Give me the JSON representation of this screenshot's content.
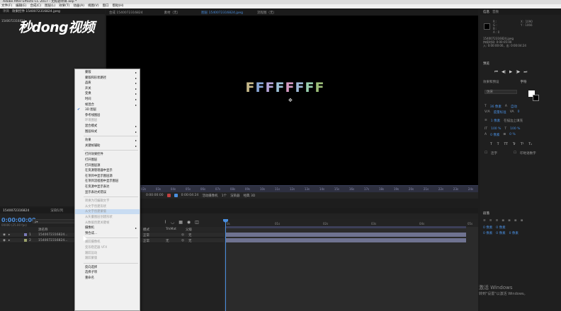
{
  "window": {
    "title_bar": "Adobe After Effects CC 2017 - 无标题项目.aep *",
    "menu": [
      "文件(F)",
      "编辑(E)",
      "合成(C)",
      "图层(L)",
      "效果(T)",
      "动画(A)",
      "视图(V)",
      "窗口",
      "帮助(H)"
    ]
  },
  "project_panel": {
    "tabs": [
      "项目",
      "效果控件 1540072316824.jpeg"
    ],
    "item_label": "1540072316824...",
    "watermark_logo": "秒dong视频"
  },
  "viewer": {
    "tabs": [
      "合成 1540072316824",
      "素材（无）",
      "图层 1540072316824.jpeg",
      "流程图（无）"
    ],
    "text_chars": [
      "F",
      "F",
      "F",
      "F",
      "F",
      "F",
      "F",
      "F"
    ],
    "text_colors": [
      "#c7b98a",
      "#8aa7d6",
      "#b6a6d8",
      "#9fc2d8",
      "#d49bc3",
      "#9fb8d6",
      "#9ad0b0",
      "#9dbf7a"
    ],
    "ruler_ticks": [
      "00s",
      "01s",
      "02s",
      "03s",
      "04s",
      "05s",
      "06s",
      "07s",
      "08s",
      "09s",
      "10s",
      "11s",
      "12s",
      "13s",
      "14s",
      "15s",
      "16s",
      "17s",
      "18s",
      "19s",
      "20s",
      "21s",
      "22s",
      "23s",
      "24s"
    ],
    "toolbar": {
      "timecode": "0:00:00:00",
      "duration": "0:00:04:24",
      "view_label": "活动摄像机",
      "view_count": "1个",
      "renderer_label": "渲染器",
      "mode_label": "经典 3D"
    }
  },
  "info_panel": {
    "tabs": [
      "信息",
      "音频"
    ],
    "rgb": [
      "R :",
      "G :",
      "B :",
      "A : 0"
    ],
    "xy": [
      "X : 1090",
      "Y : 1066"
    ],
    "file_lines": [
      "1540072316824.jpeg",
      "持续时间: 0:00:05:00",
      "入: 0:00:00:00，出: 0:00:04:24"
    ]
  },
  "preview_panel": {
    "title": "预览",
    "buttons": [
      "first-frame",
      "prev-frame",
      "play",
      "next-frame",
      "last-frame"
    ]
  },
  "character_panel": {
    "tabs": [
      "效果和预设",
      "字符"
    ],
    "font": "仿宋",
    "size": "36 像素",
    "leading": "自动",
    "tracking_label": "度量标准",
    "tracking_value": "0",
    "stroke_width": "1 像素",
    "stroke_mode": "在描边上填充",
    "vscale": "100 %",
    "hscale": "100 %",
    "baseline": "0 像素",
    "tsume": "0 %",
    "style_buttons": [
      "T",
      "T",
      "TT",
      "Tr",
      "T¹",
      "T₁"
    ],
    "checkbox_labels": [
      "连字",
      "印地语数字"
    ]
  },
  "paragraph_panel": {
    "title": "段落",
    "values": [
      "0 像素",
      "0 像素",
      "0 像素",
      "0 像素",
      "0 像素"
    ]
  },
  "timeline": {
    "tabs": [
      "1540072316824",
      "渲染队列"
    ],
    "timecode": "0:00:00:00",
    "sub_timecode": "00000 (25.00 fps)",
    "search_placeholder": "ρ▾",
    "columns": {
      "source_name": "源名称",
      "mode": "模式",
      "trkmat": "TrkMat",
      "parent": "父级"
    },
    "layers": [
      {
        "num": "1",
        "name": "1540072316824...",
        "mode": "正常",
        "trkmat": "",
        "parent": "无",
        "color": "#7a7ab8"
      },
      {
        "num": "2",
        "name": "1540072316824...",
        "mode": "正常",
        "trkmat": "无",
        "parent": "无",
        "color": "#9ca36b"
      }
    ],
    "ruler_ticks": [
      "0s",
      "01s",
      "02s",
      "03s",
      "04s",
      "05s"
    ]
  },
  "context_menu": {
    "items": [
      {
        "label": "蒙版",
        "arrow": true
      },
      {
        "label": "蒙版和形状路径",
        "arrow": true
      },
      {
        "label": "品质",
        "arrow": true
      },
      {
        "label": "开关",
        "arrow": true
      },
      {
        "label": "变换",
        "arrow": true
      },
      {
        "label": "时间",
        "arrow": true
      },
      {
        "label": "帧混合",
        "arrow": true
      },
      {
        "label": "3D 图层",
        "checked": true
      },
      {
        "label": "参考线图层"
      },
      {
        "label": "环境图层",
        "disabled": true
      },
      {
        "label": "混合模式",
        "arrow": true
      },
      {
        "label": "图层样式",
        "arrow": true
      },
      {
        "sep": true
      },
      {
        "label": "效果",
        "arrow": true
      },
      {
        "label": "关键帧辅助",
        "arrow": true
      },
      {
        "sep": true
      },
      {
        "label": "打开效果控件"
      },
      {
        "label": "打开图层"
      },
      {
        "label": "打开图层源"
      },
      {
        "label": "在资源管理器中显示"
      },
      {
        "label": "在项目中显示图层源"
      },
      {
        "label": "在项目流程图中显示图层"
      },
      {
        "label": "在资源中显示表达"
      },
      {
        "label": "显示表达式错误"
      },
      {
        "sep": true
      },
      {
        "label": "转换为可编辑文字",
        "disabled": true
      },
      {
        "label": "从文字创建形状",
        "disabled": true
      },
      {
        "label": "从文字创建蒙版",
        "disabled": true,
        "hover": true
      },
      {
        "label": "从矢量图层创建形状",
        "disabled": true
      },
      {
        "label": "从数据创建关键帧",
        "disabled": true
      },
      {
        "label": "摄像机",
        "arrow": true
      },
      {
        "label": "预合成..."
      },
      {
        "sep": true
      },
      {
        "label": "跟踪摄像机",
        "disabled": true
      },
      {
        "label": "变形稳定器 VFX",
        "disabled": true
      },
      {
        "label": "跟踪运动",
        "disabled": true
      },
      {
        "label": "跟踪蒙版",
        "disabled": true
      },
      {
        "sep": true
      },
      {
        "label": "反向选择"
      },
      {
        "label": "选择子项"
      },
      {
        "label": "重命名"
      }
    ]
  },
  "os_notice": {
    "line1": "激活 Windows",
    "line2": "转到\"设置\"以激活 Windows。"
  }
}
